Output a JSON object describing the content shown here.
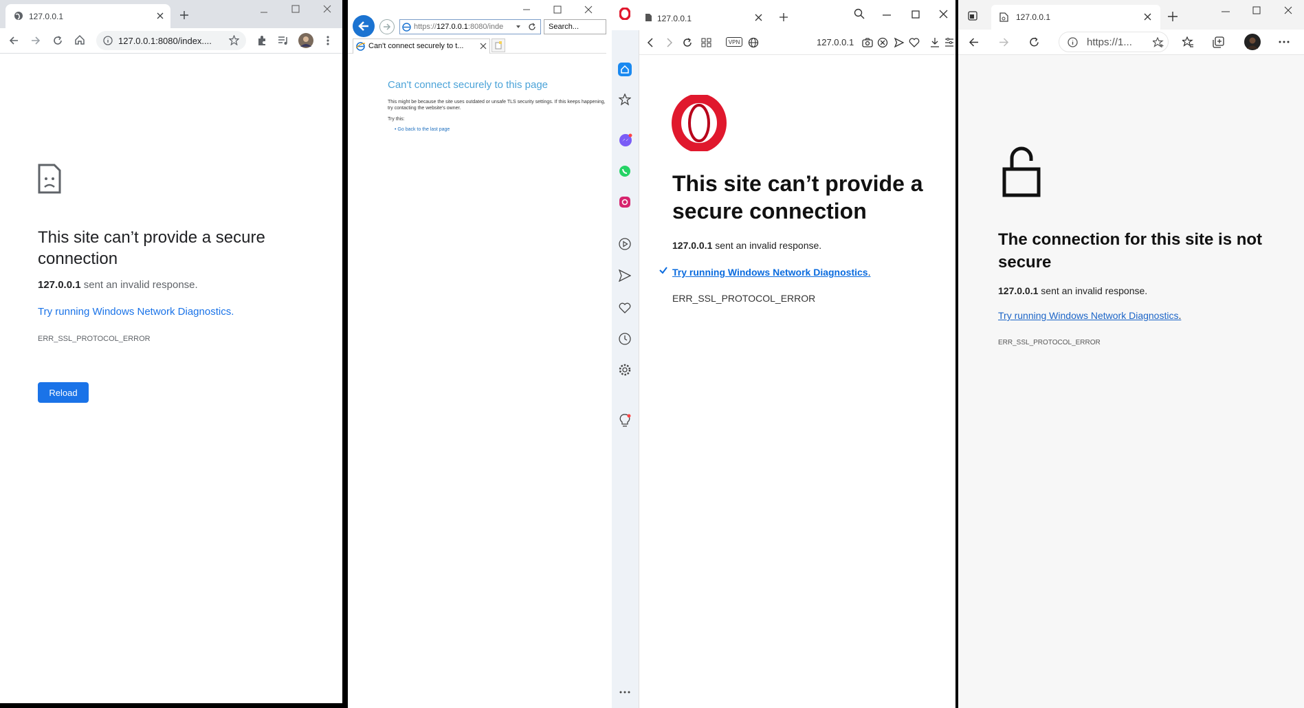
{
  "chrome": {
    "tab_title": "127.0.0.1",
    "address": "127.0.0.1:8080/index....",
    "heading": "This site can’t provide a secure connection",
    "host": "127.0.0.1",
    "message": " sent an invalid response.",
    "link": "Try running Windows Network Diagnostics.",
    "error_code": "ERR_SSL_PROTOCOL_ERROR",
    "reload_label": "Reload",
    "icons": [
      "globe-icon",
      "close-icon",
      "plus-icon",
      "minimize-icon",
      "maximize-icon",
      "back-icon",
      "forward-icon",
      "refresh-icon",
      "home-icon",
      "info-icon",
      "star-icon",
      "extensions-icon",
      "media-icon",
      "avatar",
      "menu-icon",
      "sad-page-icon"
    ],
    "accent": "#1a73e8"
  },
  "ie": {
    "address_prefix": "https://",
    "address_host": "127.0.0.1",
    "address_suffix": ":8080/inde",
    "search_placeholder": "Search...",
    "tab_title": "Can't connect securely to t...",
    "heading": "Can't connect securely to this page",
    "detail": "This might be because the site uses outdated or unsafe TLS security settings. If this keeps happening, try contacting the website's owner.",
    "try_this": "Try this:",
    "back_link": "Go back to the last page",
    "accent": "#1b73d1"
  },
  "opera": {
    "tab_title": "127.0.0.1",
    "url": "127.0.0.1",
    "vpn_label": "VPN",
    "heading": "This site can’t provide a secure connection",
    "host": "127.0.0.1",
    "message": " sent an invalid response.",
    "link": "Try running Windows Network Diagnostics",
    "link_suffix": ".",
    "error_code": "ERR_SSL_PROTOCOL_ERROR",
    "sidebar_icons": [
      "home-icon",
      "star-icon",
      "messenger-icon",
      "whatsapp-icon",
      "instagram-icon",
      "player-icon",
      "send-icon",
      "heart-icon",
      "history-icon",
      "settings-icon",
      "lightbulb-icon",
      "more-icon"
    ],
    "brand": "#e0182d"
  },
  "edge": {
    "tab_title": "127.0.0.1",
    "address": "https://1...",
    "heading": "The connection for this site is not secure",
    "host": "127.0.0.1",
    "message": " sent an invalid response.",
    "link": "Try running Windows Network Diagnostics",
    "link_suffix": ".",
    "error_code": "ERR_SSL_PROTOCOL_ERROR",
    "accent": "#1b64c7"
  }
}
